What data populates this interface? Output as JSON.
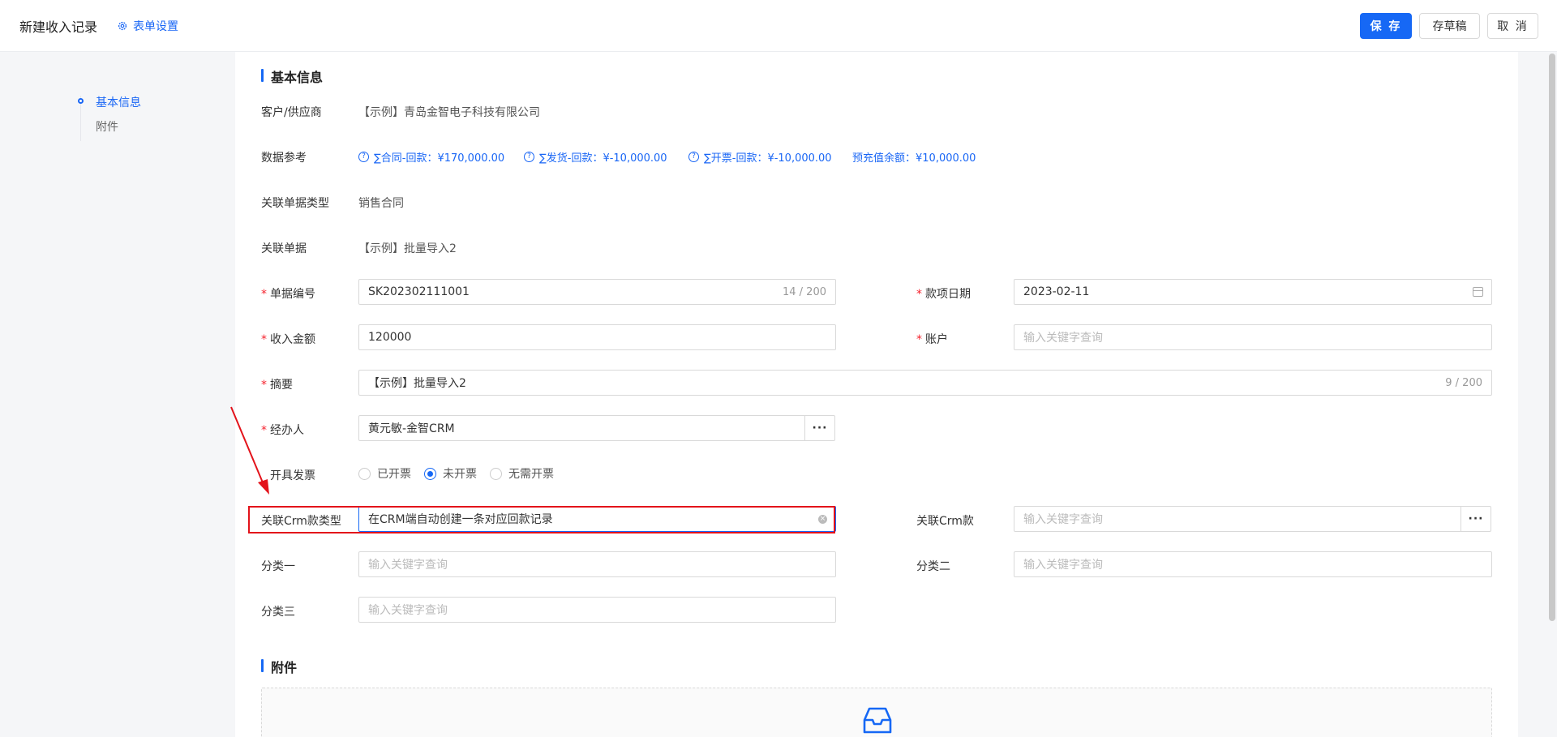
{
  "header": {
    "title": "新建收入记录",
    "form_settings": "表单设置",
    "save": "保 存",
    "draft": "存草稿",
    "cancel": "取 消"
  },
  "anchor": {
    "items": [
      {
        "label": "基本信息"
      },
      {
        "label": "附件"
      }
    ]
  },
  "basic": {
    "section_title": "基本信息",
    "customer_label": "客户/供应商",
    "customer_value": "【示例】青岛金智电子科技有限公司",
    "data_ref_label": "数据参考",
    "data_ref": [
      {
        "text": "∑合同-回款：¥170,000.00"
      },
      {
        "text": "∑发货-回款：¥-10,000.00"
      },
      {
        "text": "∑开票-回款：¥-10,000.00"
      },
      {
        "text": "预充值余额：¥10,000.00"
      }
    ],
    "related_type_label": "关联单据类型",
    "related_type_value": "销售合同",
    "related_doc_label": "关联单据",
    "related_doc_value": "【示例】批量导入2",
    "doc_no_label": "单据编号",
    "doc_no_value": "SK202302111001",
    "doc_no_count": "14 / 200",
    "date_label": "款项日期",
    "date_value": "2023-02-11",
    "amount_label": "收入金额",
    "amount_value": "120000",
    "account_label": "账户",
    "account_placeholder": "输入关键字查询",
    "summary_label": "摘要",
    "summary_value": "【示例】批量导入2",
    "summary_count": "9 / 200",
    "handler_label": "经办人",
    "handler_value": "黄元敏-金智CRM",
    "dots": "···",
    "invoice_label": "开具发票",
    "invoice_options": [
      {
        "label": "已开票",
        "checked": false
      },
      {
        "label": "未开票",
        "checked": true
      },
      {
        "label": "无需开票",
        "checked": false
      }
    ],
    "crm_type_label": "关联Crm款类型",
    "crm_type_value": "在CRM端自动创建一条对应回款记录",
    "crm_label": "关联Crm款",
    "crm_placeholder": "输入关键字查询",
    "cat1_label": "分类一",
    "cat1_placeholder": "输入关键字查询",
    "cat2_label": "分类二",
    "cat2_placeholder": "输入关键字查询",
    "cat3_label": "分类三",
    "cat3_placeholder": "输入关键字查询"
  },
  "attachment": {
    "section_title": "附件"
  },
  "colors": {
    "primary": "#1668f5",
    "link": "#1966f5",
    "required": "#f5222d",
    "annotation": "#e3131b"
  }
}
